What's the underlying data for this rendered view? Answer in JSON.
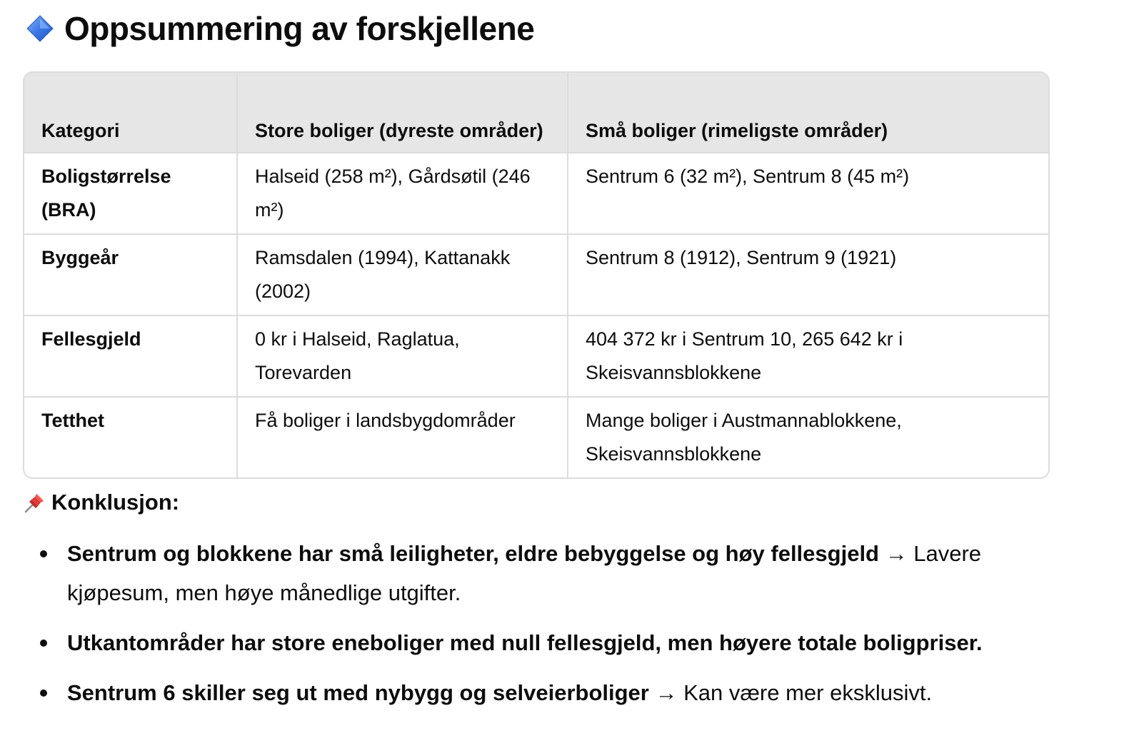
{
  "heading": {
    "icon": "blue-diamond-icon",
    "title": "Oppsummering av forskjellene"
  },
  "table": {
    "headers": [
      "Kategori",
      "Store boliger (dyreste områder)",
      "Små boliger (rimeligste områder)"
    ],
    "rows": [
      [
        "Boligstørrelse (BRA)",
        "Halseid (258 m²), Gårdsøtil (246 m²)",
        "Sentrum 6 (32 m²), Sentrum 8 (45 m²)"
      ],
      [
        "Byggeår",
        "Ramsdalen (1994), Kattanakk (2002)",
        "Sentrum 8 (1912), Sentrum 9 (1921)"
      ],
      [
        "Fellesgjeld",
        "0 kr i Halseid, Raglatua, Torevarden",
        "404 372 kr i Sentrum 10, 265 642 kr i Skeisvannsblokkene"
      ],
      [
        "Tetthet",
        "Få boliger i landsbygdområder",
        "Mange boliger i Austmannablokkene, Skeisvannsblokkene"
      ]
    ]
  },
  "conclusion": {
    "icon": "pushpin-icon",
    "title": "Konklusjon:",
    "bullets": [
      {
        "bold": "Sentrum og blokkene har små leiligheter, eldre bebyggelse og høy fellesgjeld",
        "arrow": " → ",
        "rest": "Lavere kjøpesum, men høye månedlige utgifter."
      },
      {
        "bold": "Utkantområder har store eneboliger med null fellesgjeld, men høyere totale boligpriser.",
        "arrow": "",
        "rest": ""
      },
      {
        "bold": "Sentrum 6 skiller seg ut med nybygg og selveierboliger",
        "arrow": " → ",
        "rest": "Kan være mer eksklusivt."
      }
    ]
  }
}
